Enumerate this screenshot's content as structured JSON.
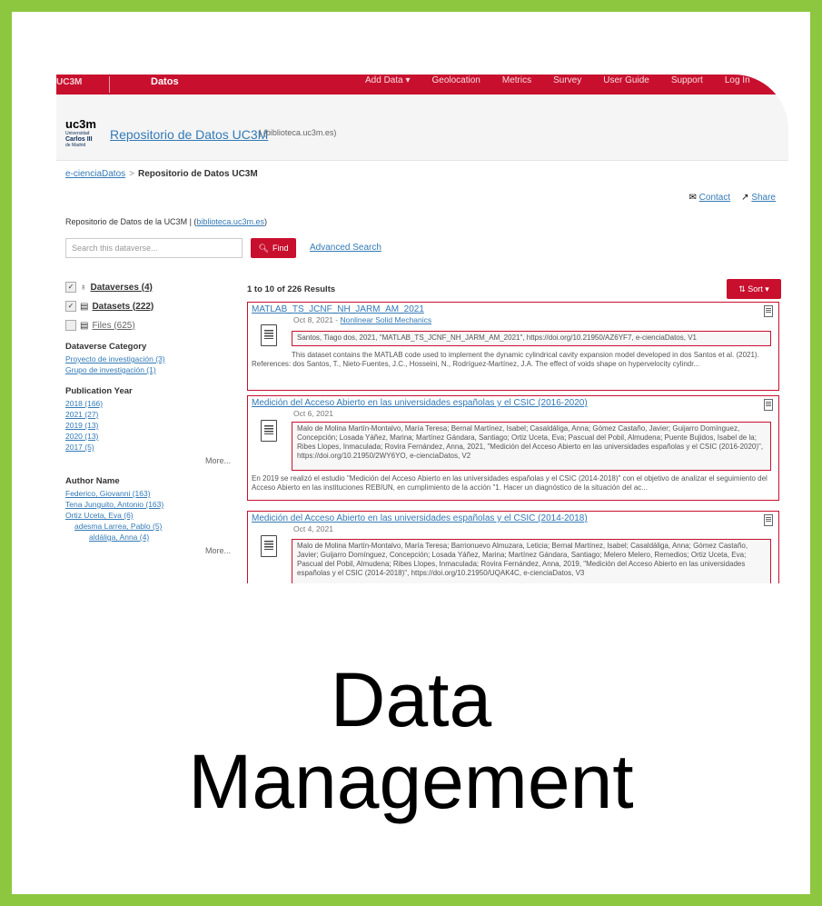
{
  "topbar": {
    "brand": "UC3M",
    "section": "Datos",
    "nav": [
      "Add Data ▾",
      "Geolocation",
      "Metrics",
      "Survey",
      "User Guide",
      "Support",
      "Log In"
    ]
  },
  "header": {
    "logo_text": "uc3m",
    "logo_university": "Universidad",
    "logo_name": "Carlos III",
    "logo_city": "de Madrid",
    "repo_title": "Repositorio de Datos UC3M",
    "repo_sub": "| (biblioteca.uc3m.es)"
  },
  "breadcrumb": {
    "root": "e-cienciaDatos",
    "current": "Repositorio de Datos UC3M"
  },
  "actions": {
    "contact": "Contact",
    "share": "Share"
  },
  "description": {
    "prefix": "Repositorio de Datos de la UC3M | (",
    "link": "biblioteca.uc3m.es",
    "suffix": ")"
  },
  "search": {
    "placeholder": "Search this dataverse...",
    "find": "Find",
    "advanced": "Advanced Search"
  },
  "facets": {
    "types": [
      {
        "label": "Dataverses (4)",
        "checked": true
      },
      {
        "label": "Datasets (222)",
        "checked": true
      },
      {
        "label": "Files (625)",
        "checked": false
      }
    ],
    "category_title": "Dataverse Category",
    "categories": [
      "Proyecto de investigación (3)",
      "Grupo de investigación (1)"
    ],
    "year_title": "Publication Year",
    "years": [
      "2018 (166)",
      "2021 (27)",
      "2019 (13)",
      "2020 (13)",
      "2017 (5)"
    ],
    "more": "More...",
    "author_title": "Author Name",
    "authors": [
      "Federico, Giovanni (163)",
      "Tena Junguito, Antonio (163)",
      "Ortiz Uceta, Eva (6)",
      "adesma Larrea, Pablo (5)",
      "aldáliga, Anna (4)"
    ]
  },
  "results": {
    "count": "1 to 10 of 226 Results",
    "sort": "Sort ▾",
    "items": [
      {
        "title": "MATLAB_TS_JCNF_NH_JARM_AM_2021",
        "date": "Oct 8, 2021 - ",
        "dataverse": "Nonlinear Solid Mechanics",
        "citation": "Santos, Tiago dos, 2021, \"MATLAB_TS_JCNF_NH_JARM_AM_2021\", https://doi.org/10.21950/AZ6YF7, e-cienciaDatos, V1",
        "abstract": "This dataset contains the MATLAB code used to implement the dynamic cylindrical cavity expansion model developed in dos Santos et al. (2021). References: dos Santos, T., Nieto-Fuentes, J.C., Hosseini, N., Rodríguez-Martínez, J.A. The effect of voids shape on hypervelocity cylindr..."
      },
      {
        "title": "Medición del Acceso Abierto en las universidades españolas y el CSIC (2016-2020)",
        "date": "Oct 6, 2021",
        "citation": "Malo de Molina Martín-Montalvo, María Teresa; Bernal Martínez, Isabel; Casaldáliga, Anna; Gómez Castaño, Javier; Guijarro Domínguez, Concepción; Losada Yáñez, Marina; Martínez Gándara, Santiago; Ortiz Uceta, Eva; Pascual del Pobil, Almudena; Puente Bujidos, Isabel de la; Ribes Llopes, Inmaculada; Rovira Fernández, Anna, 2021, \"Medición del Acceso Abierto en las universidades españolas y el CSIC (2016-2020)\", https://doi.org/10.21950/2WY6YO, e-cienciaDatos, V2",
        "abstract": "En 2019 se realizó el estudio \"Medición del Acceso Abierto en las universidades españolas y el CSIC (2014-2018)\" con el objetivo de analizar el seguimiento del Acceso Abierto en las instituciones REBIUN, en cumplimiento de la acción \"1. Hacer un diagnóstico de la situación del ac..."
      },
      {
        "title": "Medición del Acceso Abierto en las universidades españolas y el CSIC (2014-2018)",
        "date": "Oct 4, 2021",
        "citation": "Malo de Molina Martín-Montalvo, María Teresa; Barrionuevo Almuzara, Leticia; Bernal Martínez, Isabel; Casaldáliga, Anna; Gómez Castaño, Javier; Guijarro Domínguez, Concepción; Losada Yáñez, Marina; Martínez Gándara, Santiago; Melero Melero, Remedios; Ortiz Uceta, Eva; Pascual del Pobil, Almudena; Ribes Llopes, Inmaculada; Rovira Fernández, Anna, 2019, \"Medición del Acceso Abierto en las universidades españolas y el CSIC (2014-2018)\", https://doi.org/10.21950/UQAK4C, e-cienciaDatos, V3"
      }
    ]
  },
  "caption": {
    "line1": "Data",
    "line2": "Management"
  },
  "colors": {
    "border": "#8dc63f",
    "accent": "#c8102e",
    "link": "#337ab7"
  }
}
